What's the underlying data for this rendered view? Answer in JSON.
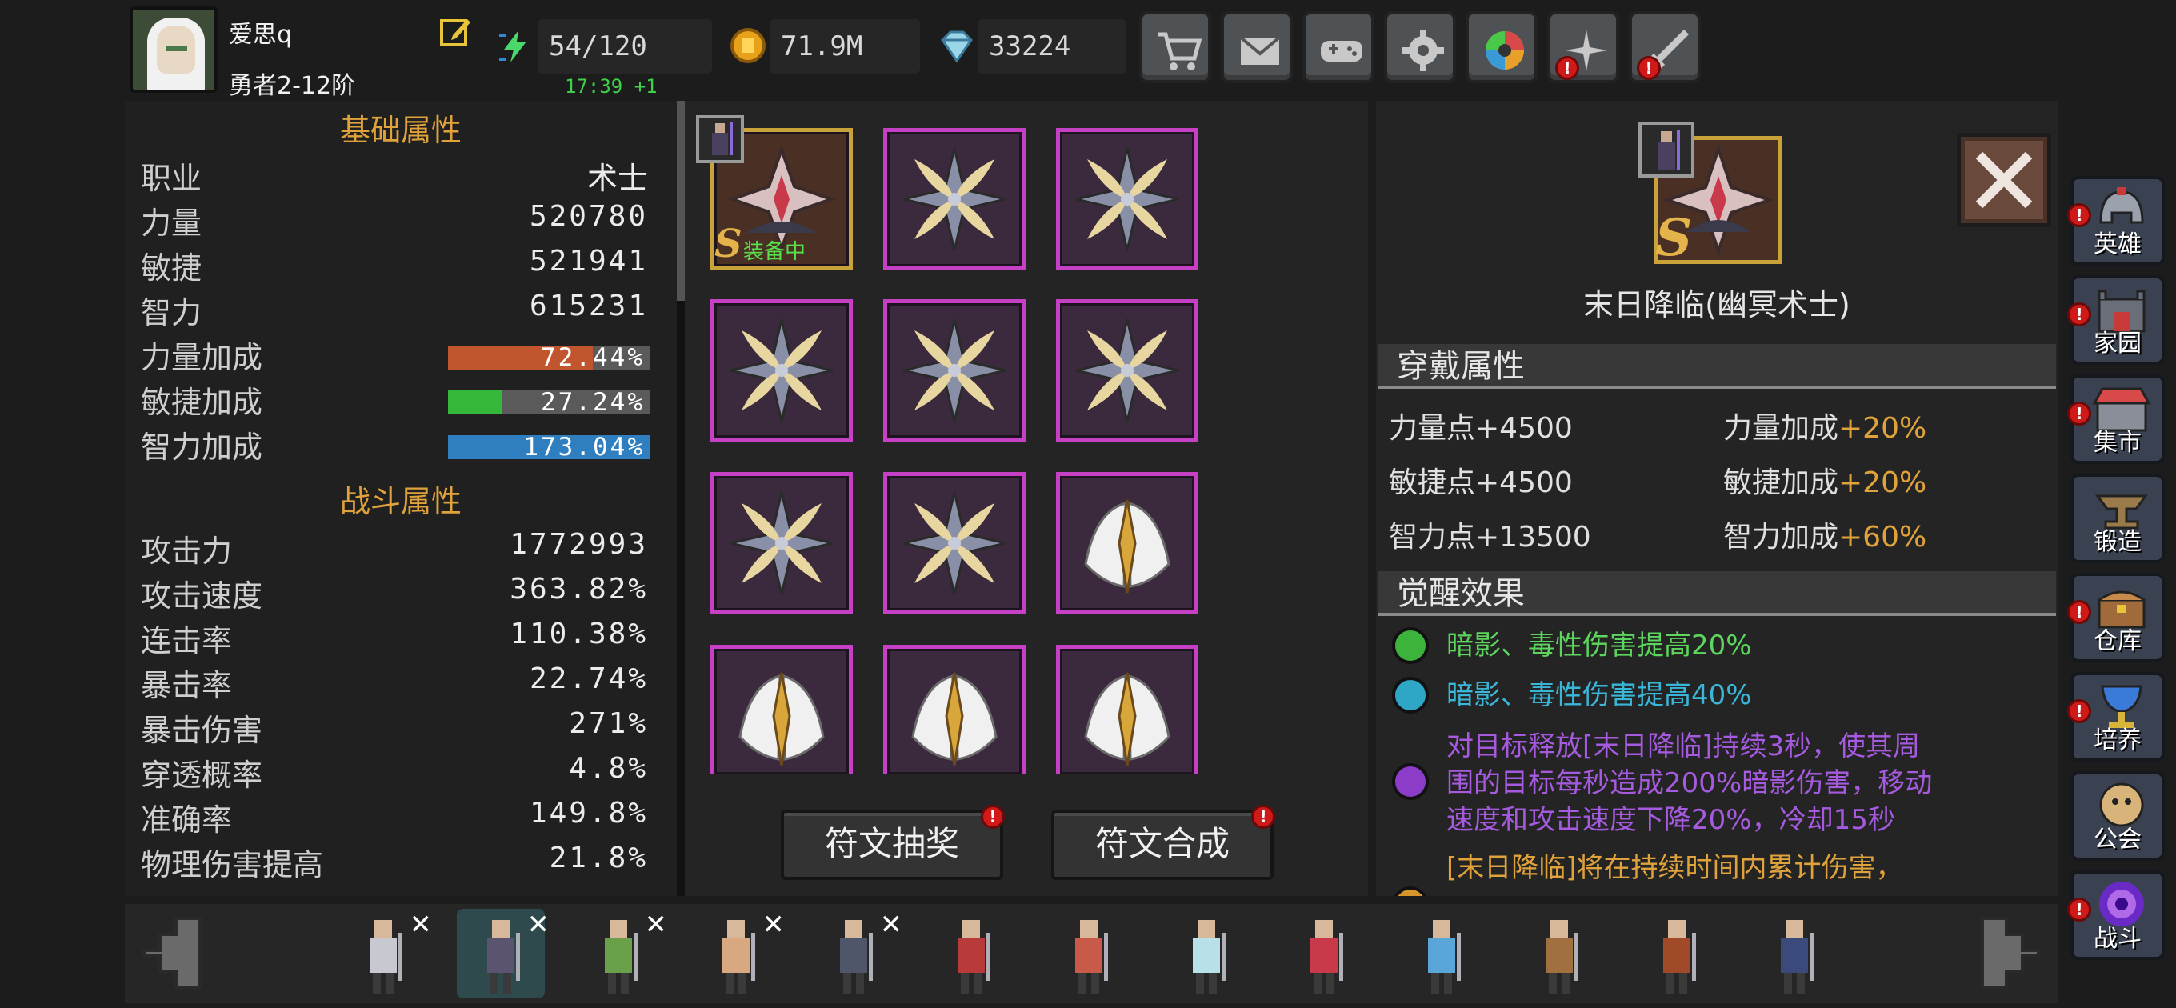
{
  "player": {
    "name": "爱思q",
    "rank": "勇者2-12阶",
    "energy": "54/120",
    "energy_timer": "17:39 +1",
    "gold": "71.9M",
    "gems": "33224"
  },
  "top_buttons": [
    {
      "name": "shop",
      "icon": "cart-icon",
      "badge": ""
    },
    {
      "name": "mail",
      "icon": "mail-icon",
      "badge": ""
    },
    {
      "name": "gamepad",
      "icon": "gamepad-icon",
      "badge": ""
    },
    {
      "name": "settings",
      "icon": "gear-icon",
      "badge": ""
    },
    {
      "name": "gacha",
      "icon": "lens-icon",
      "badge": ""
    },
    {
      "name": "sparkle",
      "icon": "sparkle-icon",
      "badge": "!"
    },
    {
      "name": "sword",
      "icon": "sword-icon",
      "badge": "!"
    }
  ],
  "left": {
    "basic_title": "基础属性",
    "job_label": "职业",
    "job_value": "术士",
    "str_label": "力量",
    "str_value": "520780",
    "agi_label": "敏捷",
    "agi_value": "521941",
    "int_label": "智力",
    "int_value": "615231",
    "str_bonus_label": "力量加成",
    "str_bonus_value": "72.44%",
    "str_bonus_fill": 0.72,
    "agi_bonus_label": "敏捷加成",
    "agi_bonus_value": "27.24%",
    "agi_bonus_fill": 0.27,
    "int_bonus_label": "智力加成",
    "int_bonus_value": "173.04%",
    "int_bonus_fill": 1.0,
    "combat_title": "战斗属性",
    "combat": [
      {
        "label": "攻击力",
        "value": "1772993"
      },
      {
        "label": "攻击速度",
        "value": "363.82%"
      },
      {
        "label": "连击率",
        "value": "110.38%"
      },
      {
        "label": "暴击率",
        "value": "22.74%"
      },
      {
        "label": "暴击伤害",
        "value": "271%"
      },
      {
        "label": "穿透概率",
        "value": "4.8%"
      },
      {
        "label": "准确率",
        "value": "149.8%"
      },
      {
        "label": "物理伤害提高",
        "value": "21.8%"
      }
    ]
  },
  "middle": {
    "equipped_tag": "装备中",
    "grade": "S",
    "runes": [
      "doom",
      "cross",
      "cross",
      "cross",
      "cross",
      "cross",
      "cross",
      "cross",
      "wings",
      "wings",
      "wings",
      "wings"
    ],
    "btn_draw": "符文抽奖",
    "btn_merge": "符文合成"
  },
  "right": {
    "item_name": "末日降临(幽冥术士)",
    "grade": "S",
    "wear_title": "穿戴属性",
    "wear": [
      {
        "stat": "力量点",
        "bonus": "+4500"
      },
      {
        "stat": "力量加成",
        "bonus": "+20%"
      },
      {
        "stat": "敏捷点",
        "bonus": "+4500"
      },
      {
        "stat": "敏捷加成",
        "bonus": "+20%"
      },
      {
        "stat": "智力点",
        "bonus": "+13500"
      },
      {
        "stat": "智力加成",
        "bonus": "+60%"
      }
    ],
    "awaken_title": "觉醒效果",
    "awaken": [
      {
        "color": "#3cb43c",
        "text_color": "#5cd65c",
        "text": "暗影、毒性伤害提高20%"
      },
      {
        "color": "#2ea6c6",
        "text_color": "#3ab7d8",
        "text": "暗影、毒性伤害提高40%"
      },
      {
        "color": "#8c3cc8",
        "text_color": "#a65ae0",
        "line1": "对目标释放[末日降临]持续3秒，使其周",
        "line2": "围的目标每秒造成200%暗影伤害，移动",
        "line3": "速度和攻击速度下降20%，冷却15秒"
      },
      {
        "color": "#d6962a",
        "text_color": "#e0a23a",
        "text": "[末日降临]将在持续时间内累计伤害，"
      }
    ]
  },
  "side_nav": [
    {
      "label": "英雄",
      "icon": "helmet-icon",
      "badge": "!"
    },
    {
      "label": "家园",
      "icon": "castle-icon",
      "badge": "!"
    },
    {
      "label": "集市",
      "icon": "market-icon",
      "badge": "!"
    },
    {
      "label": "锻造",
      "icon": "anvil-icon",
      "badge": ""
    },
    {
      "label": "仓库",
      "icon": "chest-icon",
      "badge": "!"
    },
    {
      "label": "培养",
      "icon": "chalice-icon",
      "badge": "!"
    },
    {
      "label": "公会",
      "icon": "guild-icon",
      "badge": ""
    },
    {
      "label": "战斗",
      "icon": "portal-icon",
      "badge": "!"
    }
  ],
  "heroes": [
    {
      "name": "hero-1",
      "crossed": true,
      "color": "#c8c8d0"
    },
    {
      "name": "hero-2",
      "crossed": true,
      "color": "#5a5470",
      "selected": true
    },
    {
      "name": "hero-3",
      "crossed": true,
      "color": "#6aa04a"
    },
    {
      "name": "hero-4",
      "crossed": true,
      "color": "#d8a880"
    },
    {
      "name": "hero-5",
      "crossed": true,
      "color": "#50566a"
    },
    {
      "name": "hero-6",
      "crossed": false,
      "color": "#b83a3a"
    },
    {
      "name": "hero-7",
      "crossed": false,
      "color": "#c85a4a"
    },
    {
      "name": "hero-8",
      "crossed": false,
      "color": "#b8e0e8"
    },
    {
      "name": "hero-9",
      "crossed": false,
      "color": "#c83a4a"
    },
    {
      "name": "hero-10",
      "crossed": false,
      "color": "#5aa6d8"
    },
    {
      "name": "hero-11",
      "crossed": false,
      "color": "#a07040"
    },
    {
      "name": "hero-12",
      "crossed": false,
      "color": "#a04a2a"
    },
    {
      "name": "hero-13",
      "crossed": false,
      "color": "#3a4a7a"
    }
  ],
  "colors": {
    "accent_gold": "#e0a23a",
    "rune_border": "#c640c6",
    "str_bar": "#c0552e",
    "agi_bar": "#35b83a",
    "int_bar": "#2e7ec0"
  }
}
